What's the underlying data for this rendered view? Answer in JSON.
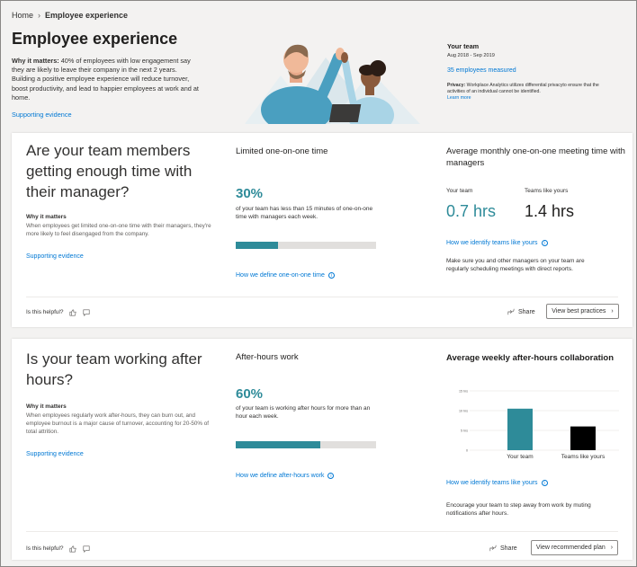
{
  "breadcrumb": {
    "home": "Home",
    "current": "Employee experience"
  },
  "page": {
    "title": "Employee experience",
    "why_label": "Why it matters:",
    "why_text": "40% of employees with low engagement say they are likely to leave their company in the next 2 years. Building a positive employee experience will reduce turnover, boost productivity, and lead to happier employees at work and at home.",
    "supporting_link": "Supporting evidence"
  },
  "team": {
    "title": "Your team",
    "dates": "Aug 2018 - Sep 2019",
    "count_link": "35 employees measured",
    "privacy_label": "Privacy:",
    "privacy_text": "Workplace Analytics utilizes differential privacyto ensure that the activities of an individual cannot be identified.",
    "learn_more": "Learn more"
  },
  "card1": {
    "question": "Are your team members getting enough time with their manager?",
    "why_label": "Why it matters",
    "why_text": "When employees get limited one-on-one time with their managers, they're more likely to feel disengaged from the company.",
    "evidence_link": "Supporting evidence",
    "metric_title": "Limited one-on-one time",
    "metric_pct": "30%",
    "metric_fraction": 0.3,
    "metric_desc": "of your team has less than 15 minutes of one-on-one time with managers each week.",
    "define_link": "How we define one-on-one time",
    "right_title": "Average monthly one-on-one meeting time with managers",
    "kpi_team_label": "Your team",
    "kpi_team_value": "0.7 hrs",
    "kpi_peer_label": "Teams like yours",
    "kpi_peer_value": "1.4 hrs",
    "identify_link": "How we identify teams like yours",
    "tip": "Make sure you and other managers on your team are regularly scheduling meetings with direct reports.",
    "helpful": "Is this helpful?",
    "share": "Share",
    "action": "View best practices"
  },
  "card2": {
    "question": "Is your team working after hours?",
    "why_label": "Why it matters",
    "why_text": "When employees regularly work after-hours, they can burn out, and employee burnout is a major cause of turnover, accounting for 20-50% of total attrition.",
    "evidence_link": "Supporting evidence",
    "metric_title": "After-hours work",
    "metric_pct": "60%",
    "metric_fraction": 0.6,
    "metric_desc": "of your team is working after hours for more than an hour each week.",
    "define_link": "How we define after-hours work",
    "right_title": "Average weekly after-hours collaboration",
    "identify_link": "How we identify teams like yours",
    "tip": "Encourage your team to step away from work by muting notifications after hours.",
    "helpful": "Is this helpful?",
    "share": "Share",
    "action": "View recommended plan"
  },
  "chart_data": {
    "type": "bar",
    "categories": [
      "Your team",
      "Teams like yours"
    ],
    "values": [
      10.5,
      6
    ],
    "ylim": [
      0,
      15
    ],
    "yticks": [
      0,
      5,
      10,
      15
    ],
    "ytick_labels": [
      "0",
      "5 hrs",
      "10 hrs",
      "15 hrs"
    ],
    "colors": [
      "#2e8b99",
      "#000000"
    ],
    "grid": true
  },
  "colors": {
    "accent": "#2e8b99",
    "link": "#0078d4"
  },
  "icons": {
    "chevron": "chevron-right-icon",
    "like": "thumbs-up-icon",
    "comment": "comment-icon",
    "share": "share-icon",
    "info": "info-icon"
  }
}
